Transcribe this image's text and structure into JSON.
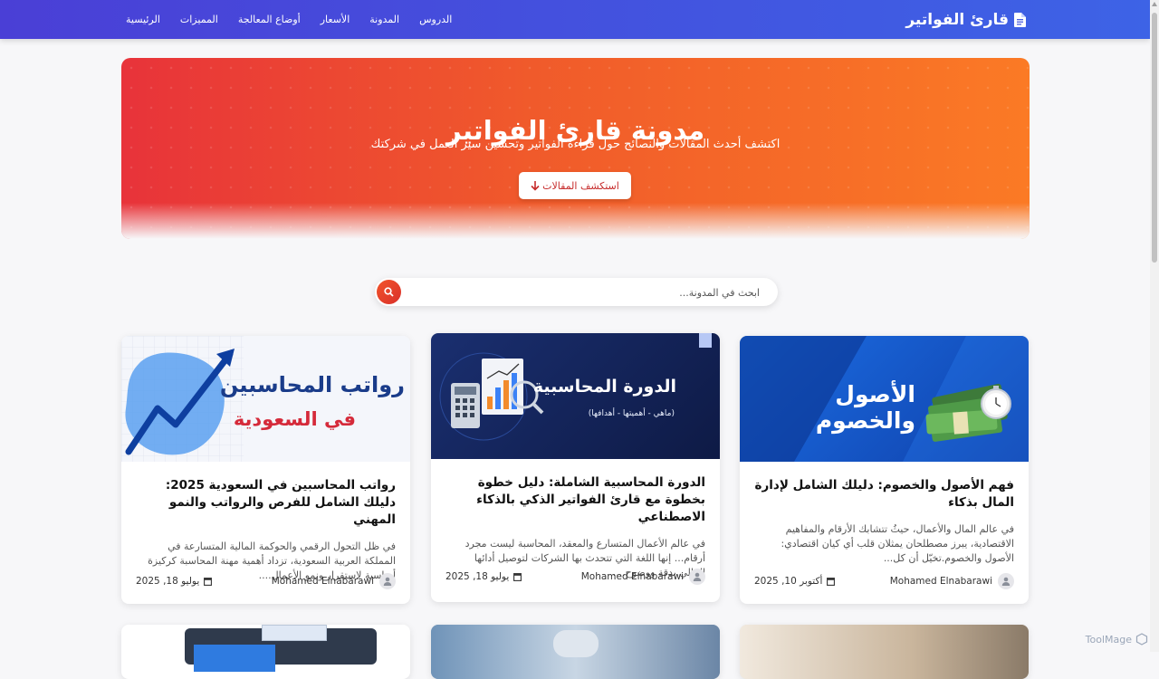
{
  "nav": {
    "brand": "قارئ الفواتير",
    "links": [
      "الرئيسية",
      "المميزات",
      "أوضاع المعالجة",
      "الأسعار",
      "المدونة",
      "الدروس"
    ]
  },
  "hero": {
    "title": "مدونة قارئ الفواتير",
    "subtitle": "اكتشف أحدث المقالات والنصائح حول قراءة الفواتير وتحسين سير العمل في شركتك",
    "button_label": "استكشف المقالات"
  },
  "search": {
    "placeholder": "ابحث في المدونة..."
  },
  "cards": [
    {
      "image_title": "الأصول والخصوم",
      "title": "فهم الأصول والخصوم: دليلك الشامل لإدارة المال بذكاء",
      "excerpt": "في عالم المال والأعمال، حيثُ تتشابك الأرقام والمفاهيم الاقتصادية، يبرز مصطلحان يمثلان قلب أي كيان اقتصادي: الأصول والخصوم.تخيّل أن كل...",
      "author": "Mohamed Elnabarawi",
      "date": "أكتوبر 10, 2025"
    },
    {
      "image_title": "الدورة المحاسبية",
      "image_subtitle": "(ماهي - أهميتها - أهدافها)",
      "title": "الدورة المحاسبية الشاملة: دليل خطوة بخطوة مع قارئ الفواتير الذكي بالذكاء الاصطناعي",
      "excerpt": "في عالم الأعمال المتسارع والمعقد، المحاسبة ليست مجرد أرقام... إنها اللغة التي تتحدث بها الشركات لتوصيل أدائها المالي بدقة ووضوح....",
      "author": "Mohamed Elnabarawi",
      "date": "يوليو 18, 2025"
    },
    {
      "image_title": "رواتب المحاسبين",
      "image_subtitle": "في السعودية",
      "title": "رواتب المحاسبين في السعودية 2025: دليلك الشامل للفرص والرواتب والنمو المهني",
      "excerpt": "في ظل التحول الرقمي والحوكمة المالية المتسارعة في المملكة العربية السعودية، تزداد أهمية مهنة المحاسبة كركيزة أساسية لاستقرار ونمو الأعمال....",
      "author": "Mohamed Elnabarawi",
      "date": "يوليو 18, 2025"
    }
  ],
  "watermark": "ToolMage",
  "colors": {
    "nav_start": "#4a3fd6",
    "nav_end": "#3d63e6",
    "hero_start": "#e8333a",
    "hero_end": "#fb7a25",
    "accent": "#e8462c"
  }
}
